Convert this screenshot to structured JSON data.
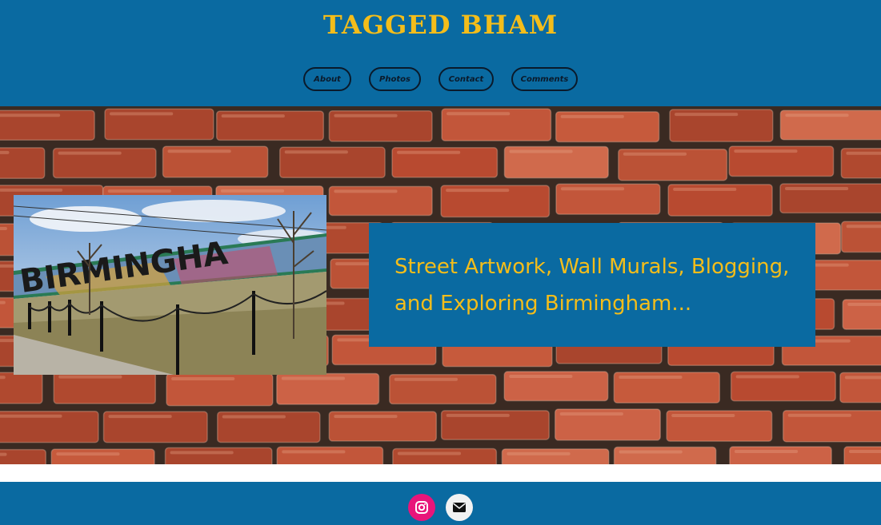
{
  "site": {
    "title": "TAGGED BHAM"
  },
  "nav": {
    "items": [
      {
        "label": "About"
      },
      {
        "label": "Photos"
      },
      {
        "label": "Contact"
      },
      {
        "label": "Comments"
      }
    ]
  },
  "hero": {
    "background": "brick-wall",
    "photo_subject": "BIRMINGHAM mural",
    "tagline_line1": "Street Artwork, Wall Murals, Blogging,",
    "tagline_line2": "and Exploring Birmingham..."
  },
  "footer": {
    "social": [
      {
        "icon": "instagram-icon",
        "color": "#e8157a"
      },
      {
        "icon": "mail-icon",
        "color": "#f2f2f2"
      }
    ]
  },
  "colors": {
    "header_bg": "#0a6aa1",
    "accent_gold": "#f4bd1a",
    "nav_border": "#0a1a2b",
    "brick": "#c2563a"
  }
}
